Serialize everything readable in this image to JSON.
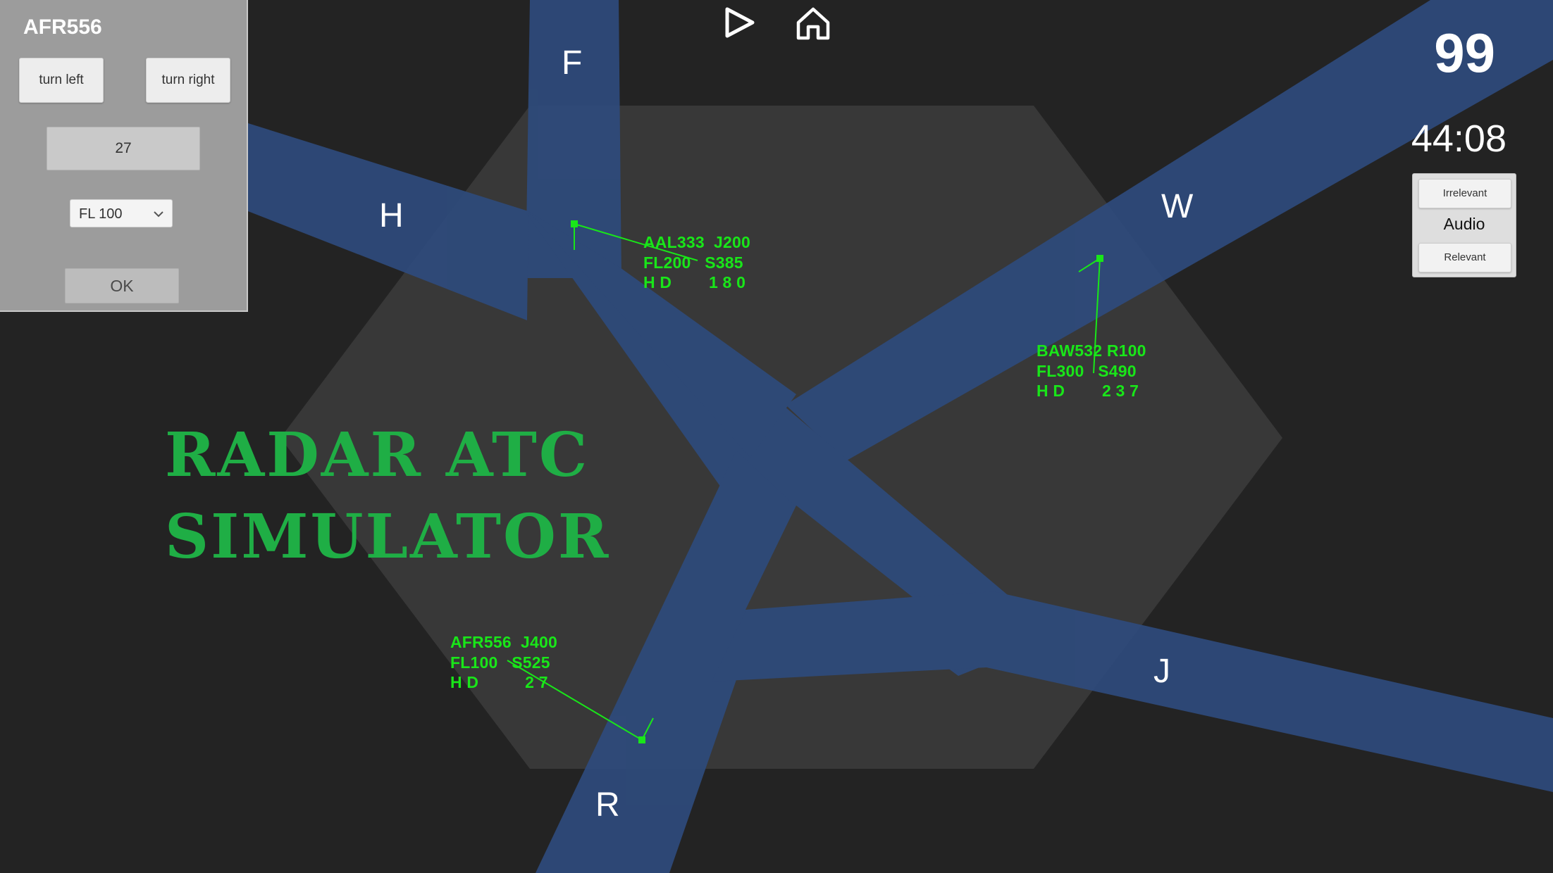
{
  "panel": {
    "callsign": "AFR556",
    "turn_left_label": "turn left",
    "turn_right_label": "turn right",
    "heading_value": "27",
    "flight_level_selected": "FL 100",
    "ok_label": "OK"
  },
  "toolbar": {
    "play_icon": "play-icon",
    "home_icon": "home-icon"
  },
  "hud": {
    "score": "99",
    "clock": "44:08"
  },
  "audio": {
    "irrelevant_label": "Irrelevant",
    "title": "Audio",
    "relevant_label": "Relevant"
  },
  "fixes": {
    "f": "F",
    "h": "H",
    "w": "W",
    "j": "J",
    "r": "R"
  },
  "aircraft": [
    {
      "callsign": "AAL333",
      "route": "J200",
      "flight_level": "FL200",
      "speed": "S385",
      "heading_label": "H D",
      "heading": "1 8 0"
    },
    {
      "callsign": "BAW532",
      "route": "R100",
      "flight_level": "FL300",
      "speed": "S490",
      "heading_label": "H D",
      "heading": "2 3 7"
    },
    {
      "callsign": "AFR556",
      "route": "J400",
      "flight_level": "FL100",
      "speed": "S525",
      "heading_label": "H D",
      "heading": "2 7"
    }
  ],
  "title": {
    "line1": "RADAR ATC",
    "line2": "SIMULATOR"
  },
  "colors": {
    "background": "#232323",
    "sector": "#3a3a3a",
    "airway": "#2e4a7a",
    "tag_green": "#19e619",
    "title_green": "#1fae45",
    "panel_gray": "#9c9c9c"
  }
}
